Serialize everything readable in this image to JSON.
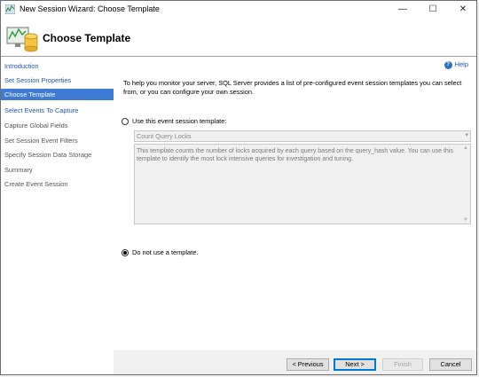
{
  "window": {
    "title": "New Session Wizard: Choose Template",
    "minimize": "—",
    "maximize": "☐",
    "close": "✕"
  },
  "header": {
    "title": "Choose Template"
  },
  "sidebar": {
    "items": [
      {
        "label": "Introduction",
        "state": "link"
      },
      {
        "label": "Set Session Properties",
        "state": "link"
      },
      {
        "label": "Choose Template",
        "state": "active"
      },
      {
        "label": "Select Events To Capture",
        "state": "link"
      },
      {
        "label": "Capture Global Fields",
        "state": "normal"
      },
      {
        "label": "Set Session Event Filters",
        "state": "normal"
      },
      {
        "label": "Specify Session Data Storage",
        "state": "normal"
      },
      {
        "label": "Summary",
        "state": "normal"
      },
      {
        "label": "Create Event Session",
        "state": "normal"
      }
    ]
  },
  "content": {
    "help_label": "Help",
    "intro": "To help you monitor your server, SQL Server provides a list of pre-configured event session templates you can select from, or you can configure your own session.",
    "use_template_label": "Use this event session template:",
    "template_selected": "Count Query Locks",
    "template_description": "This template counts the number of locks acquired by each query based on the query_hash value. You can use this template to identify the most lock intensive queries for investigation and tuning.",
    "no_template_label": "Do not use a template.",
    "selected_option": "no_template"
  },
  "buttons": {
    "previous": "< Previous",
    "next": "Next >",
    "finish": "Finish",
    "cancel": "Cancel"
  },
  "icons": {
    "dropdown": "▾",
    "scroll_up": "▲",
    "scroll_down": "▼"
  },
  "colors": {
    "accent": "#3d7bd4",
    "link": "#1a57b6"
  }
}
